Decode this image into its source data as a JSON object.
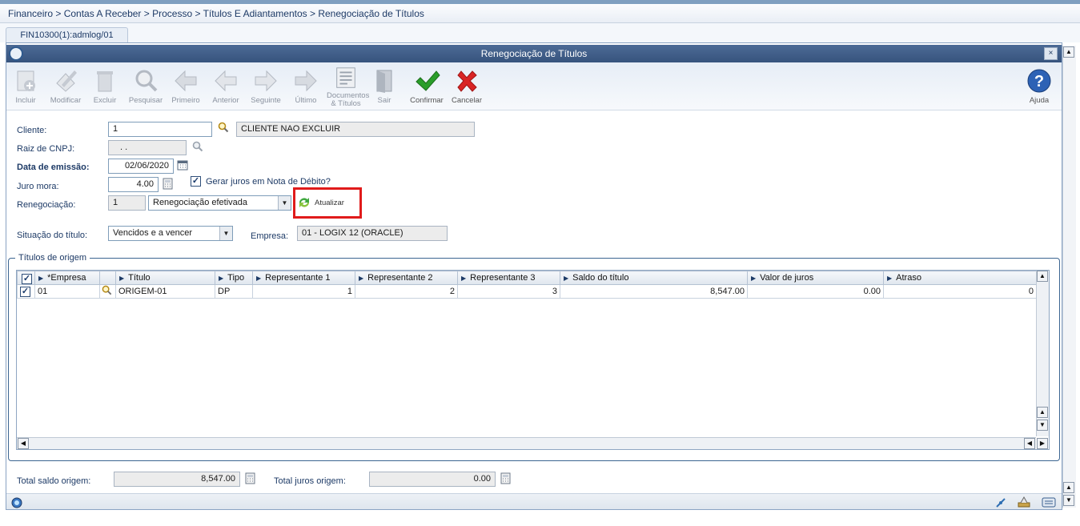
{
  "breadcrumb": "Financeiro > Contas A Receber > Processo > Títulos E Adiantamentos > Renegociação de Títulos",
  "tab_label": "FIN10300(1):admlog/01",
  "window_title": "Renegociação de Títulos",
  "close_glyph": "×",
  "toolbar": {
    "incluir": "Incluir",
    "modificar": "Modificar",
    "excluir": "Excluir",
    "pesquisar": "Pesquisar",
    "primeiro": "Primeiro",
    "anterior": "Anterior",
    "seguinte": "Seguinte",
    "ultimo": "Último",
    "documentos_1": "Documentos",
    "documentos_2": "& Títulos",
    "sair": "Sair",
    "confirmar": "Confirmar",
    "cancelar": "Cancelar",
    "ajuda": "Ajuda"
  },
  "form": {
    "cliente_label": "Cliente:",
    "cliente_value": "1",
    "cliente_nome": "CLIENTE NAO EXCLUIR",
    "raiz_cnpj_label": "Raiz de CNPJ:",
    "raiz_cnpj_value": ".   .",
    "data_emissao_label": "Data de emissão:",
    "data_emissao_value": "02/06/2020",
    "juro_mora_label": "Juro mora:",
    "juro_mora_value": "4.00",
    "gerar_juros_label": "Gerar juros em Nota de Débito?",
    "gerar_juros_checked": "✓",
    "renegociacao_label": "Renegociação:",
    "renegociacao_value": "1",
    "renegociacao_status": "Renegociação efetivada",
    "atualizar_label": "Atualizar",
    "situacao_label": "Situação do título:",
    "situacao_value": "Vencidos e a vencer",
    "empresa_label": "Empresa:",
    "empresa_value": "01 - LOGIX 12 (ORACLE)"
  },
  "group_title": "Títulos de origem",
  "grid": {
    "headers": [
      "*Empresa",
      "Título",
      "Tipo",
      "Representante 1",
      "Representante 2",
      "Representante 3",
      "Saldo do título",
      "Valor de juros",
      "Atraso"
    ],
    "rows": [
      {
        "checked": "✓",
        "empresa": "01",
        "titulo": "ORIGEM-01",
        "tipo": "DP",
        "rep1": "1",
        "rep2": "2",
        "rep3": "3",
        "saldo": "8,547.00",
        "juros": "0.00",
        "atraso": "0"
      }
    ]
  },
  "totals": {
    "saldo_label": "Total saldo origem:",
    "saldo_value": "8,547.00",
    "juros_label": "Total juros origem:",
    "juros_value": "0.00"
  },
  "colors": {
    "titlebar": "#3f5e8a",
    "highlight": "#e01b1b",
    "confirm": "#2a9d2a",
    "cancel": "#d92424"
  }
}
